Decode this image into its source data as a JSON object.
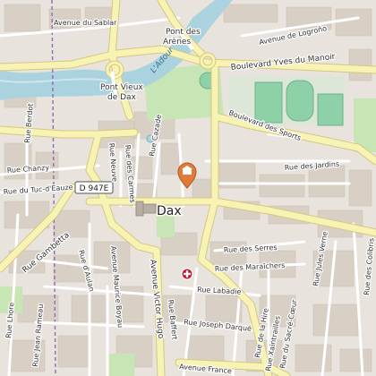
{
  "city": "Dax",
  "river": "L'Adour",
  "route_badge": "D 947E",
  "colors": {
    "land": "#e8e3dc",
    "buildings": "#d8cfc5",
    "water": "#aad3df",
    "park": "#c8e6b5",
    "sports": "#8ed0a8",
    "major_road": "#f7f3b4",
    "minor_road": "#ffffff",
    "marker_orange": "#e07b39",
    "hospital_red": "#c8102e",
    "railway": "#8e6bb5"
  },
  "labels": {
    "avenue_sablar": "Avenue du Sablar",
    "pont_arenes_1": "Pont des",
    "pont_arenes_2": "Arènes",
    "avenue_logrono": "Avenue de Logroño",
    "boulevard_yves": "Boulevard Yves du Manoir",
    "pont_vieux_1": "Pont Vieux",
    "pont_vieux_2": "de Dax",
    "boulevard_sports": "Boulevard des Sports",
    "rue_jardins": "Rue des Jardins",
    "rue_chanzy": "Rue Chanzy",
    "rue_tuc": "Rue du Tuc-d'Eauze",
    "rue_gambetta": "Rue Gambetta",
    "rue_aulan": "Rue d'Aulan",
    "rue_carmes": "Rue des Carmes",
    "rue_neuve": "Rue Neuve",
    "rue_cazade": "Rue Cazade",
    "rue_berdot": "Rue Berdot",
    "rue_serres": "Rue des Serres",
    "rue_maraichers": "Rue des Maraîchers",
    "rue_labadie": "Rue Labadie",
    "avenue_maurice": "Avenue Maurice Boyau",
    "avenue_victor": "Avenue Victor Hugo",
    "rue_baffert": "Rue Baffert",
    "rue_joseph": "Rue Joseph Darqué",
    "rue_lhore": "Rue Lhore",
    "rue_jean": "Rue Jean Rameau",
    "rue_jules": "Rue Jules Verne",
    "avenue_france": "Avenue France",
    "rue_colibris": "Rue des Colibris",
    "rue_hire": "Rue de la Hire",
    "rue_xaintrailles": "Rue Xaintrailles",
    "rue_sacre": "Rue du Sacré-Cœur"
  }
}
